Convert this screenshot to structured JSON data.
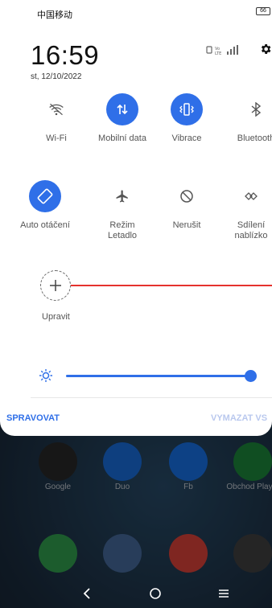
{
  "status": {
    "carrier": "中国移动",
    "battery": "66"
  },
  "header": {
    "time": "16:59",
    "date": "st, 12/10/2022"
  },
  "tiles_row1": [
    {
      "label": "Wi-Fi",
      "icon": "wifi-off-icon",
      "active": false
    },
    {
      "label": "Mobilní data",
      "icon": "mobile-data-icon",
      "active": true
    },
    {
      "label": "Vibrace",
      "icon": "vibrate-icon",
      "active": true
    },
    {
      "label": "Bluetooth",
      "icon": "bluetooth-icon",
      "active": false
    }
  ],
  "tiles_row2": [
    {
      "label": "Auto otáčení",
      "icon": "auto-rotate-icon",
      "active": true
    },
    {
      "label": "Režim\nLetadlo",
      "icon": "airplane-icon",
      "active": false
    },
    {
      "label": "Nerušit",
      "icon": "do-not-disturb-icon",
      "active": false
    },
    {
      "label": "Sdílení\nnablízko",
      "icon": "nearby-share-icon",
      "active": false
    }
  ],
  "edit": {
    "label": "Upravit"
  },
  "brightness": {
    "level": 1.0
  },
  "footer": {
    "manage": "SPRAVOVAT",
    "clear": "VYMAZAT VS"
  },
  "home_apps": [
    {
      "label": "Google"
    },
    {
      "label": "Duo"
    },
    {
      "label": "Fb"
    },
    {
      "label": "Obchod Play"
    }
  ],
  "colors": {
    "accent": "#2f6fe8",
    "edit_line": "#e5322e"
  }
}
